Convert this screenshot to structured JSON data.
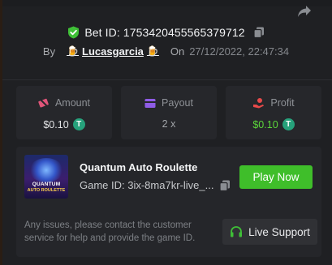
{
  "header": {
    "bet_id_label": "Bet ID: 1753420455565379712",
    "by_label": "By",
    "username": "Lucasgarcia",
    "user_emoji": "🍺",
    "on_label": "On",
    "date": "27/12/2022, 22:47:34"
  },
  "stats": [
    {
      "title": "Amount",
      "value": "$0.10",
      "icon": "money-off-icon",
      "color": "#e05579",
      "coin": "tether-coin-icon"
    },
    {
      "title": "Payout",
      "value": "2 x",
      "icon": "wallet-icon",
      "color": "#8f5ce6"
    },
    {
      "title": "Profit",
      "value": "$0.10",
      "icon": "profit-hand-icon",
      "color": "#e84a4a",
      "coin": "tether-coin-icon"
    }
  ],
  "coin_symbol": "T",
  "game": {
    "thumbnail_title": "QUANTUM",
    "thumbnail_subtitle": "AUTO ROULETTE",
    "title": "Quantum Auto Roulette",
    "game_id": "Game ID: 3ix-8ma7kr-live_...",
    "play_label": "Play Now"
  },
  "support": {
    "help_text": "Any issues, please contact the customer service for help and provide the game ID.",
    "button_label": "Live Support"
  },
  "colors": {
    "accent_green": "#3fbe2a",
    "profit_green": "#5bd63a",
    "background": "#1f2023",
    "card": "#26272b"
  }
}
